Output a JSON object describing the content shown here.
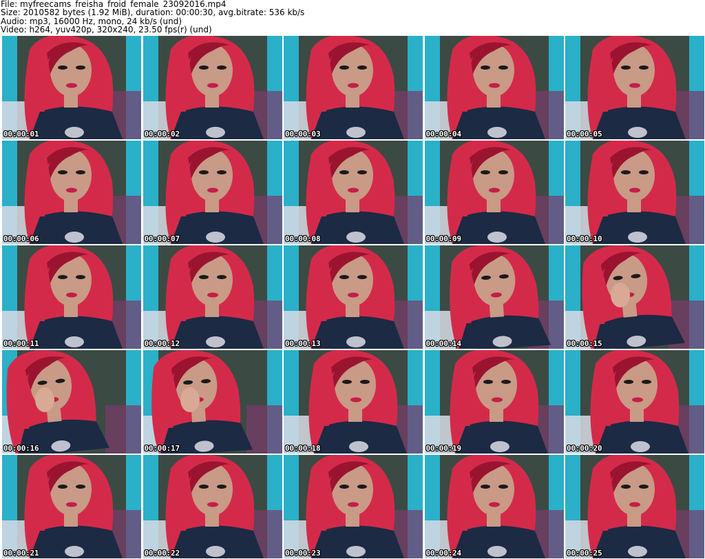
{
  "header": {
    "file_line": "File: myfreecams_freisha_froid_female_23092016.mp4",
    "size_line": "Size: 2010582 bytes (1.92 MiB), duration: 00:00:30, avg.bitrate: 536 kb/s",
    "audio_line": "Audio: mp3, 16000 Hz, mono, 24 kb/s (und)",
    "video_line": "Video: h264, yuv420p, 320x240, 23.50 fps(r) (und)"
  },
  "colors": {
    "hair": "#d42a4a",
    "hair_dark": "#9a1430",
    "skin": "#c99a86",
    "shirt": "#1c2a44",
    "curtain_teal": "#2ab0c8",
    "wall": "#3c4a44",
    "timestamp_text": "#ffffff"
  },
  "frames": [
    {
      "time": "00:00:01"
    },
    {
      "time": "00:00:02"
    },
    {
      "time": "00:00:03"
    },
    {
      "time": "00:00:04"
    },
    {
      "time": "00:00:05"
    },
    {
      "time": "00:00:06"
    },
    {
      "time": "00:00:07"
    },
    {
      "time": "00:00:08"
    },
    {
      "time": "00:00:09"
    },
    {
      "time": "00:00:10"
    },
    {
      "time": "00:00:11"
    },
    {
      "time": "00:00:12"
    },
    {
      "time": "00:00:13"
    },
    {
      "time": "00:00:14"
    },
    {
      "time": "00:00:15"
    },
    {
      "time": "00:00:16"
    },
    {
      "time": "00:00:17"
    },
    {
      "time": "00:00:18"
    },
    {
      "time": "00:00:19"
    },
    {
      "time": "00:00:20"
    },
    {
      "time": "00:00:21"
    },
    {
      "time": "00:00:22"
    },
    {
      "time": "00:00:23"
    },
    {
      "time": "00:00:24"
    },
    {
      "time": "00:00:25"
    }
  ]
}
